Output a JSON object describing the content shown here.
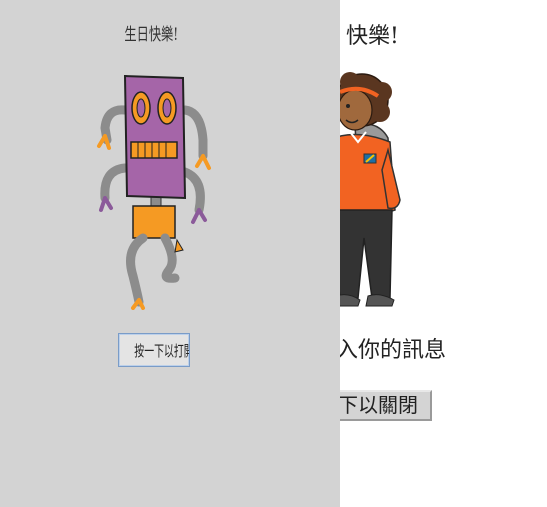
{
  "inside": {
    "title": "快樂!",
    "message": "入你的訊息",
    "close_button_label": "下以關閉"
  },
  "cover": {
    "title": "生日快樂!",
    "open_button_label": "按一下以打開"
  },
  "colors": {
    "cover_background": "#d3d3d3",
    "robot_body": "#a565a8",
    "robot_accent": "#f59a23",
    "robot_limbs": "#8c8c8c",
    "girl_sweater": "#f26322",
    "girl_pants": "#333333"
  },
  "icons": {
    "robot": "robot-illustration",
    "girl": "girl-illustration"
  }
}
